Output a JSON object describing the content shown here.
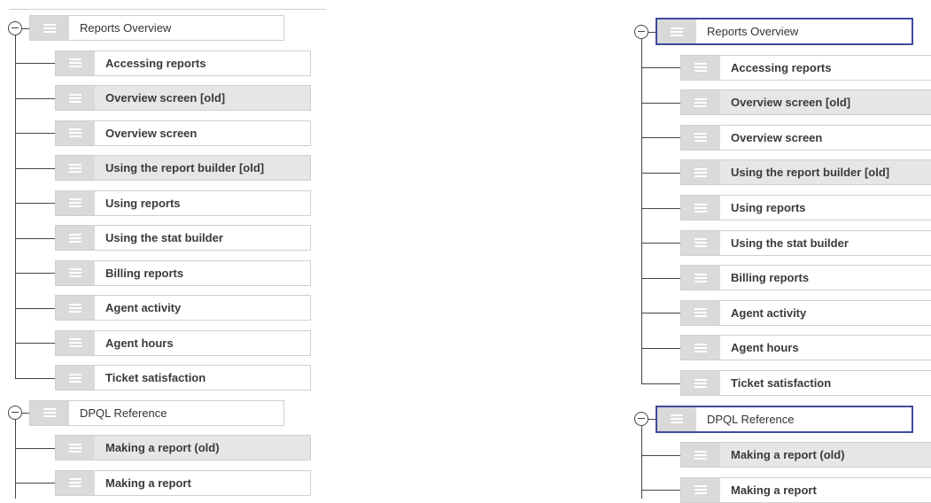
{
  "tree": {
    "groups": [
      {
        "label": "Reports Overview",
        "children": [
          {
            "label": "Accessing reports",
            "shaded": false
          },
          {
            "label": "Overview screen [old]",
            "shaded": true
          },
          {
            "label": "Overview screen",
            "shaded": false
          },
          {
            "label": "Using the report builder [old]",
            "shaded": true
          },
          {
            "label": "Using reports",
            "shaded": false
          },
          {
            "label": "Using the stat builder",
            "shaded": false
          },
          {
            "label": "Billing reports",
            "shaded": false
          },
          {
            "label": "Agent activity",
            "shaded": false
          },
          {
            "label": "Agent hours",
            "shaded": false
          },
          {
            "label": "Ticket satisfaction",
            "shaded": false
          }
        ]
      },
      {
        "label": "DPQL Reference",
        "children": [
          {
            "label": "Making a report (old)",
            "shaded": true
          },
          {
            "label": "Making a report",
            "shaded": false
          }
        ]
      }
    ]
  },
  "icons": {
    "toggle": "collapse-minus-icon",
    "handle": "drag-handle-icon"
  },
  "colors": {
    "selected_border": "#3d4a9e",
    "shaded_row": "#e6e6e6",
    "handle": "#d9d9d9"
  }
}
